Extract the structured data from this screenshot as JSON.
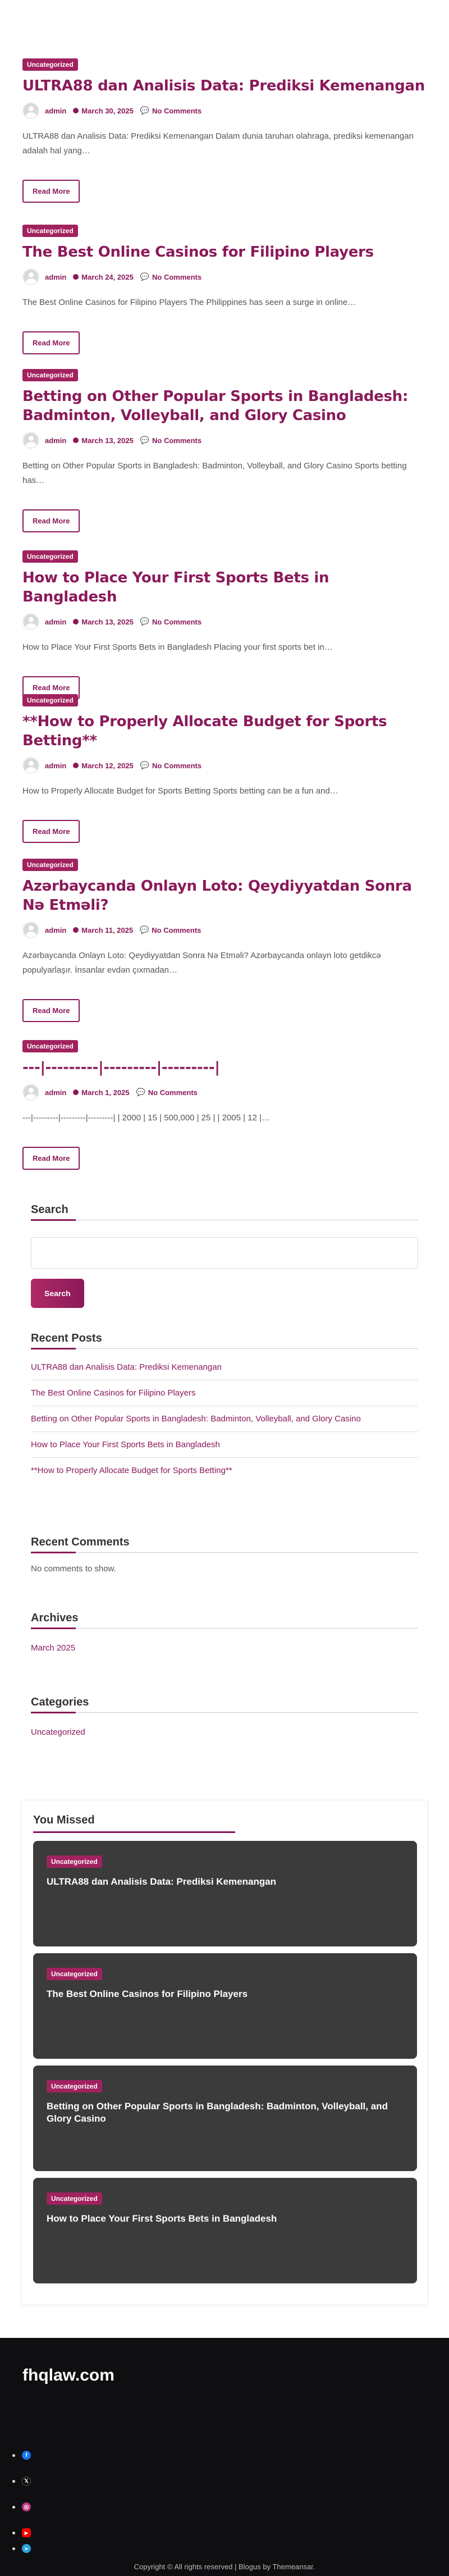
{
  "posts": [
    {
      "category": "Uncategorized",
      "title": "ULTRA88 dan Analisis Data: Prediksi Kemenangan",
      "author": "admin",
      "date": "March 30, 2025",
      "comments": "No Comments",
      "excerpt": "ULTRA88 dan Analisis Data: Prediksi Kemenangan Dalam dunia taruhan olahraga, prediksi kemenangan adalah hal yang…",
      "read_more": "Read More"
    },
    {
      "category": "Uncategorized",
      "title": "The Best Online Casinos for Filipino Players",
      "author": "admin",
      "date": "March 24, 2025",
      "comments": "No Comments",
      "excerpt": "The Best Online Casinos for Filipino Players The Philippines has seen a surge in online…",
      "read_more": "Read More"
    },
    {
      "category": "Uncategorized",
      "title": "Betting on Other Popular Sports in Bangladesh: Badminton, Volleyball, and Glory Casino",
      "author": "admin",
      "date": "March 13, 2025",
      "comments": "No Comments",
      "excerpt": "Betting on Other Popular Sports in Bangladesh: Badminton, Volleyball, and Glory Casino Sports betting has…",
      "read_more": "Read More"
    },
    {
      "category": "Uncategorized",
      "title": "How to Place Your First Sports Bets in Bangladesh",
      "author": "admin",
      "date": "March 13, 2025",
      "comments": "No Comments",
      "excerpt": "How to Place Your First Sports Bets in Bangladesh Placing your first sports bet in…",
      "read_more": "Read More"
    },
    {
      "category": "Uncategorized",
      "title": "**How to Properly Allocate Budget for Sports Betting**",
      "author": "admin",
      "date": "March 12, 2025",
      "comments": "No Comments",
      "excerpt": "How to Properly Allocate Budget for Sports Betting Sports betting can be a fun and…",
      "read_more": "Read More"
    },
    {
      "category": "Uncategorized",
      "title": "Azərbaycanda Onlayn Loto: Qeydiyyatdan Sonra Nə Etməli?",
      "author": "admin",
      "date": "March 11, 2025",
      "comments": "No Comments",
      "excerpt": "Azərbaycanda Onlayn Loto: Qeydiyyatdan Sonra Nə Etməli? Azərbaycanda onlayn loto getdikcə populyarlaşır. İnsanlar evdən çıxmadan…",
      "read_more": "Read More"
    },
    {
      "category": "Uncategorized",
      "title": "---|---------|---------|---------|",
      "author": "admin",
      "date": "March 1, 2025",
      "comments": "No Comments",
      "excerpt": "---|---------|---------|---------| | 2000 | 15 | 500,000 | 25 | | 2005 | 12 |…",
      "read_more": "Read More"
    }
  ],
  "search": {
    "title": "Search",
    "button": "Search",
    "placeholder": ""
  },
  "recent_posts": {
    "title": "Recent Posts",
    "items": [
      "ULTRA88 dan Analisis Data: Prediksi Kemenangan",
      "The Best Online Casinos for Filipino Players",
      "Betting on Other Popular Sports in Bangladesh: Badminton, Volleyball, and Glory Casino",
      "How to Place Your First Sports Bets in Bangladesh",
      "**How to Properly Allocate Budget for Sports Betting**"
    ]
  },
  "recent_comments": {
    "title": "Recent Comments",
    "empty": "No comments to show."
  },
  "archives": {
    "title": "Archives",
    "items": [
      "March 2025"
    ]
  },
  "categories": {
    "title": "Categories",
    "items": [
      "Uncategorized"
    ]
  },
  "you_missed": {
    "title": "You Missed",
    "cards": [
      {
        "category": "Uncategorized",
        "title": "ULTRA88 dan Analisis Data: Prediksi Kemenangan"
      },
      {
        "category": "Uncategorized",
        "title": "The Best Online Casinos for Filipino Players"
      },
      {
        "category": "Uncategorized",
        "title": "Betting on Other Popular Sports in Bangladesh: Badminton, Volleyball, and Glory Casino"
      },
      {
        "category": "Uncategorized",
        "title": "How to Place Your First Sports Bets in Bangladesh"
      }
    ]
  },
  "footer": {
    "site_name": "fhqlaw.com",
    "social": [
      {
        "icon": "facebook-icon",
        "glyph": "f",
        "color": "#1877f2"
      },
      {
        "icon": "x-twitter-icon",
        "glyph": "𝕏",
        "color": "#000000"
      },
      {
        "icon": "instagram-icon",
        "glyph": "◎",
        "color": "#c13584"
      },
      {
        "icon": "youtube-icon",
        "glyph": "▶",
        "color": "#ff0000"
      },
      {
        "icon": "telegram-icon",
        "glyph": "➤",
        "color": "#2aa3df"
      }
    ],
    "copyright": "Copyright © All rights reserved | Blogus by Themeansar."
  },
  "colors": {
    "accent": "#8a1a5a",
    "badge": "#a1225f",
    "card_bg": "#3b3b3b",
    "footer_bg": "#0f0f12"
  }
}
